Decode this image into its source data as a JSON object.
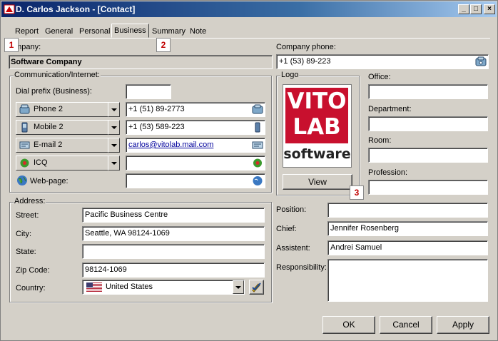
{
  "window": {
    "title": "D. Carlos Jackson - [Contact]"
  },
  "titlebar_buttons": {
    "minimize": "_",
    "maximize": "□",
    "close": "×"
  },
  "tabs": [
    {
      "label": "Report"
    },
    {
      "label": "General"
    },
    {
      "label": "Personal"
    },
    {
      "label": "Business"
    },
    {
      "label": "Summary"
    },
    {
      "label": "Note"
    }
  ],
  "markers": {
    "m1": "1",
    "m2": "2",
    "m3": "3"
  },
  "company": {
    "label": "ompany:",
    "value": "Software Company"
  },
  "company_phone": {
    "label": "Company phone:",
    "value": "+1 (53) 89-223"
  },
  "communication": {
    "group_label": "Communication/Internet:",
    "dial_prefix_label": "Dial prefix (Business):",
    "dial_prefix_value": "",
    "rows": [
      {
        "type": "Phone 2",
        "value": "+1 (51) 89-2773",
        "icon": "phone-icon"
      },
      {
        "type": "Mobile 2",
        "value": "+1 (53) 589-223",
        "icon": "mobile-icon"
      },
      {
        "type": "E-mail 2",
        "value": "carlos@vitolab.mail.com",
        "icon": "email-icon"
      },
      {
        "type": "ICQ",
        "value": "",
        "icon": "icq-icon"
      }
    ],
    "webpage_label": "Web-page:",
    "webpage_value": ""
  },
  "logo": {
    "group_label": "Logo",
    "line1": "VITO",
    "line2": "LAB",
    "line3": "software",
    "view_button": "View"
  },
  "right_fields": {
    "office_label": "Office:",
    "office_value": "",
    "department_label": "Department:",
    "department_value": "",
    "room_label": "Room:",
    "room_value": "",
    "profession_label": "Profession:",
    "profession_value": "",
    "position_label": "Position:",
    "position_value": "",
    "chief_label": "Chief:",
    "chief_value": "Jennifer Rosenberg",
    "assistent_label": "Assistent:",
    "assistent_value": "Andrei Samuel",
    "responsibility_label": "Responsibility:",
    "responsibility_value": ""
  },
  "address": {
    "group_label": "Address:",
    "street_label": "Street:",
    "street_value": "Pacific Business Centre",
    "city_label": "City:",
    "city_value": "Seattle, WA 98124-1069",
    "state_label": "State:",
    "state_value": "",
    "zip_label": "Zip Code:",
    "zip_value": "98124-1069",
    "country_label": "Country:",
    "country_value": "United States"
  },
  "buttons": {
    "ok": "OK",
    "cancel": "Cancel",
    "apply": "Apply"
  },
  "colors": {
    "accent": "#0a246a",
    "marker": "#c00000",
    "logo_red": "#c8102e"
  }
}
